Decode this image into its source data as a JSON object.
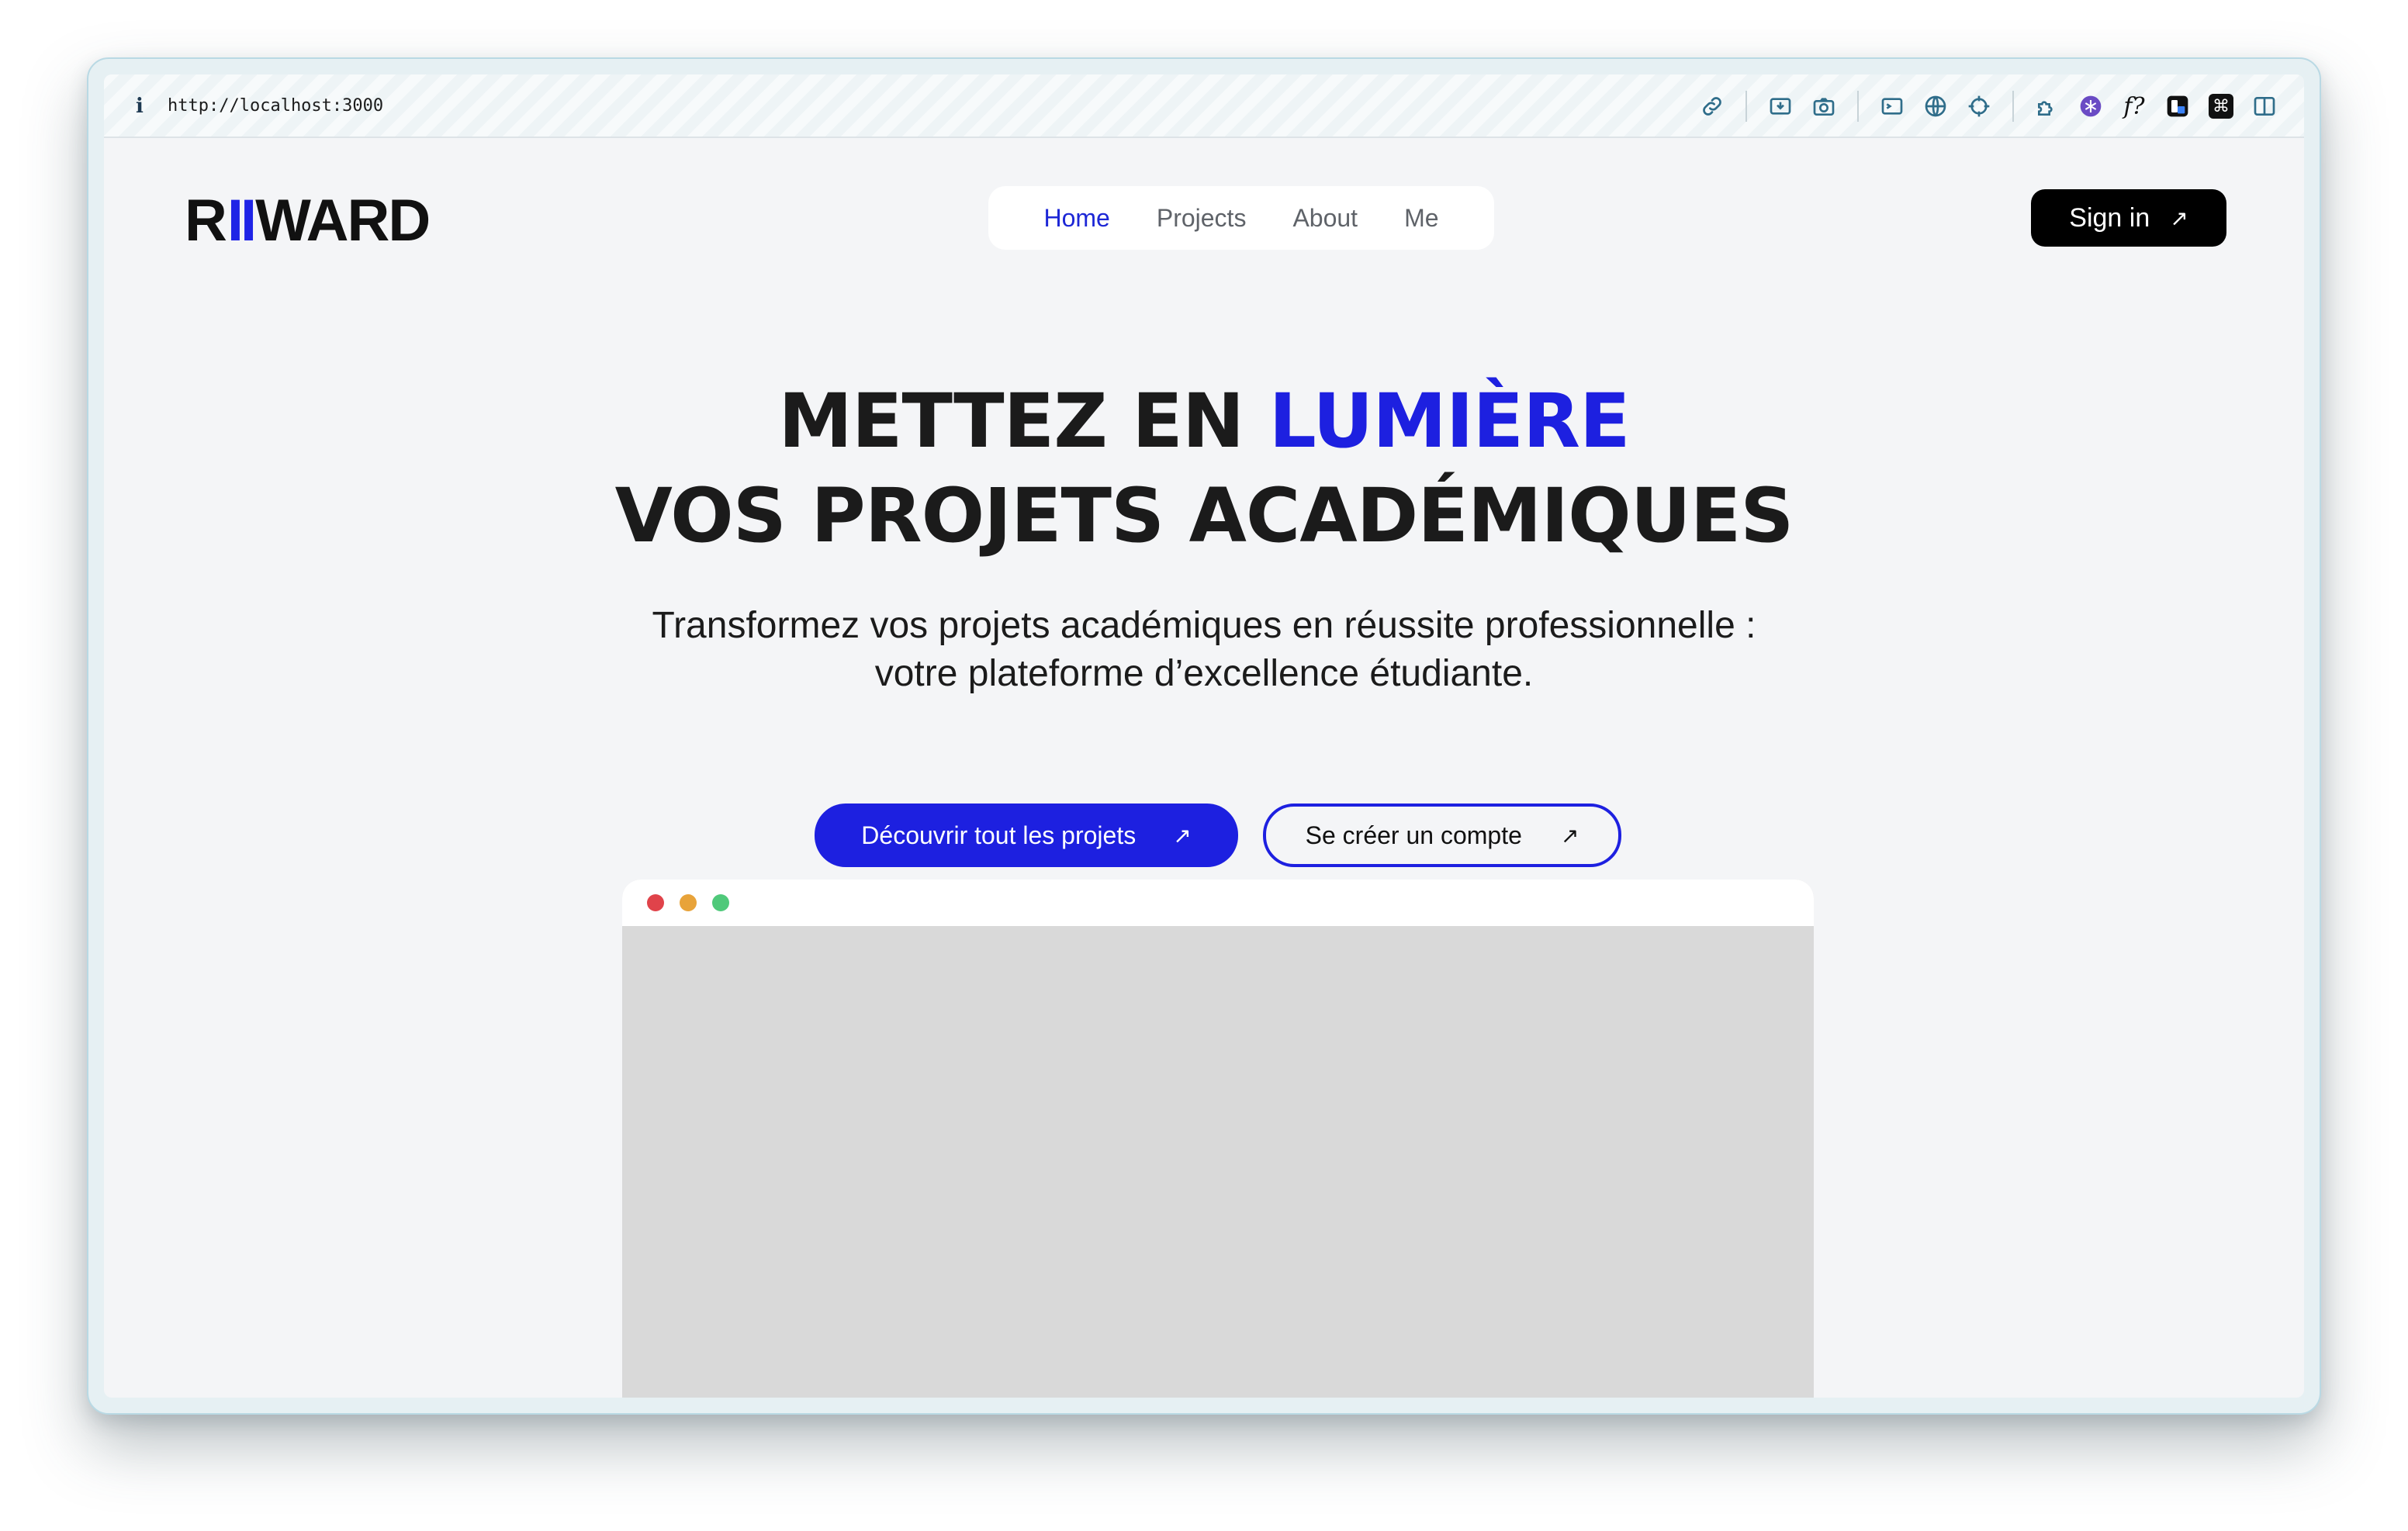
{
  "browser": {
    "url": "http://localhost:3000",
    "toolbar_icons": [
      "link-icon",
      "download-icon",
      "camera-icon",
      "terminal-icon",
      "globe-icon",
      "crosshair-icon",
      "puzzle-icon",
      "snowflake-icon",
      "function-icon",
      "extension-icon",
      "command-icon",
      "sidebar-icon"
    ],
    "function_glyph": "f?",
    "command_glyph": "⌘"
  },
  "logo": {
    "part1": "R",
    "part2": "II",
    "part3": "WARD",
    "accent_color": "#1f24e6"
  },
  "nav": {
    "items": [
      {
        "label": "Home",
        "active": true
      },
      {
        "label": "Projects",
        "active": false
      },
      {
        "label": "About",
        "active": false
      },
      {
        "label": "Me",
        "active": false
      }
    ]
  },
  "header": {
    "signin_label": "Sign in",
    "arrow": "↗"
  },
  "hero": {
    "title_line1_prefix": "METTEZ EN ",
    "title_line1_accent": "LUMIÈRE",
    "title_line2": "VOS PROJETS ACADÉMIQUES",
    "subtitle_line1": "Transformez vos projets académiques en réussite professionnelle :",
    "subtitle_line2": "votre plateforme d’excellence étudiante.",
    "cta_primary": "Découvrir tout les projets",
    "cta_secondary": "Se créer un compte",
    "accent_color": "#1d20e0"
  },
  "preview": {
    "dot_colors": [
      "#e0434a",
      "#e8a33a",
      "#4fc97a"
    ]
  }
}
